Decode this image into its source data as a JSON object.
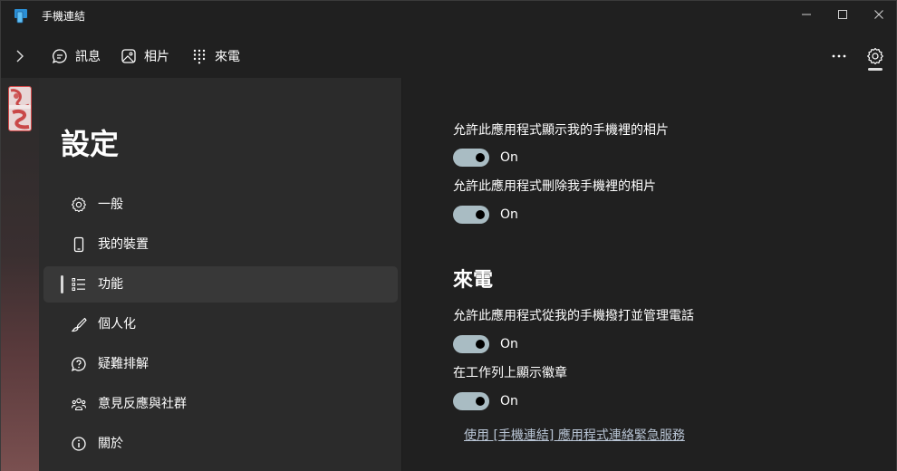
{
  "window": {
    "title": "手機連結"
  },
  "nav": {
    "tabs": [
      {
        "label": "訊息",
        "icon": "chat-icon"
      },
      {
        "label": "相片",
        "icon": "photo-icon"
      },
      {
        "label": "來電",
        "icon": "dialpad-icon"
      }
    ],
    "more_icon": "ellipsis-icon",
    "settings_icon": "gear-icon"
  },
  "settings": {
    "title": "設定",
    "menu": [
      {
        "label": "一般",
        "icon": "gear-icon",
        "active": false
      },
      {
        "label": "我的裝置",
        "icon": "phone-icon",
        "active": false
      },
      {
        "label": "功能",
        "icon": "list-icon",
        "active": true
      },
      {
        "label": "個人化",
        "icon": "brush-icon",
        "active": false
      },
      {
        "label": "疑難排解",
        "icon": "troubleshoot-icon",
        "active": false
      },
      {
        "label": "意見反應與社群",
        "icon": "people-icon",
        "active": false
      },
      {
        "label": "關於",
        "icon": "info-icon",
        "active": false
      }
    ]
  },
  "content": {
    "photos": [
      {
        "label": "允許此應用程式顯示我的手機裡的相片",
        "state": "On",
        "on": true
      },
      {
        "label": "允許此應用程式刪除我手機裡的相片",
        "state": "On",
        "on": true
      }
    ],
    "calls_heading": "來電",
    "calls": [
      {
        "label": "允許此應用程式從我的手機撥打並管理電話",
        "state": "On",
        "on": true
      },
      {
        "label": "在工作列上顯示徽章",
        "state": "On",
        "on": true
      }
    ],
    "link": "使用 [手機連結] 應用程式連絡緊急服務"
  },
  "colors": {
    "toggle_on": "#a9bcc3",
    "panel_bg": "#2b2b2b",
    "content_bg": "#202020"
  }
}
